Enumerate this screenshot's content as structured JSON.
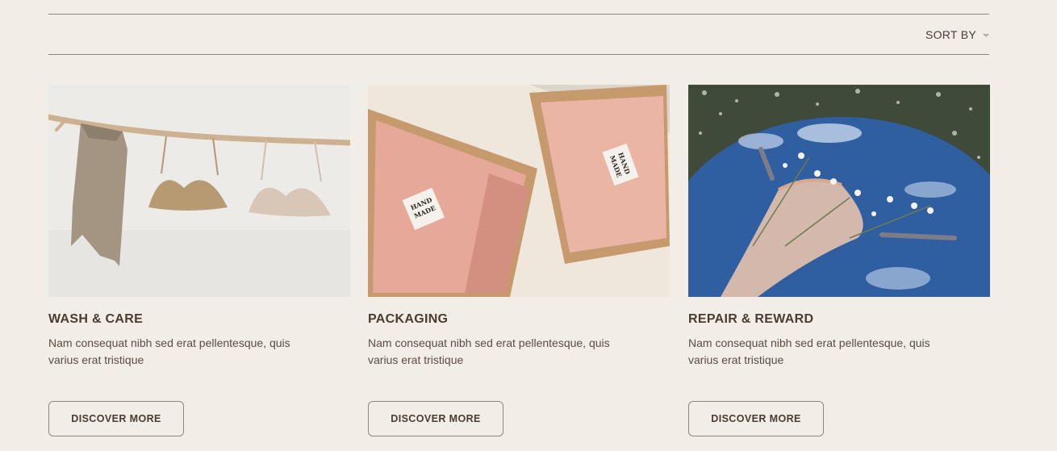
{
  "toolbar": {
    "sort_label": "SORT BY",
    "sort_icon": "chevron-down-icon"
  },
  "cards": [
    {
      "title": "WASH & CARE",
      "description": "Nam consequat nibh sed erat pellentesque, quis varius erat tristique",
      "button_label": "DISCOVER MORE",
      "image_subject": "bralettes-and-scarf-on-branch"
    },
    {
      "title": "PACKAGING",
      "description": "Nam consequat nibh sed erat pellentesque, quis varius erat tristique",
      "button_label": "DISCOVER MORE",
      "image_subject": "handmade-boxes-pink-tissue",
      "tag_text": [
        "HAND",
        "MADE"
      ]
    },
    {
      "title": "REPAIR & REWARD",
      "description": "Nam consequat nibh sed erat pellentesque, quis varius erat tristique",
      "button_label": "DISCOVER MORE",
      "image_subject": "garment-on-mirror-with-flowers"
    }
  ],
  "colors": {
    "background": "#f2ede6",
    "text": "#4a3c32",
    "divider": "#8f8780",
    "mirror_blue": "#2f5fa0",
    "tissue_pink": "#e8ad9f"
  }
}
